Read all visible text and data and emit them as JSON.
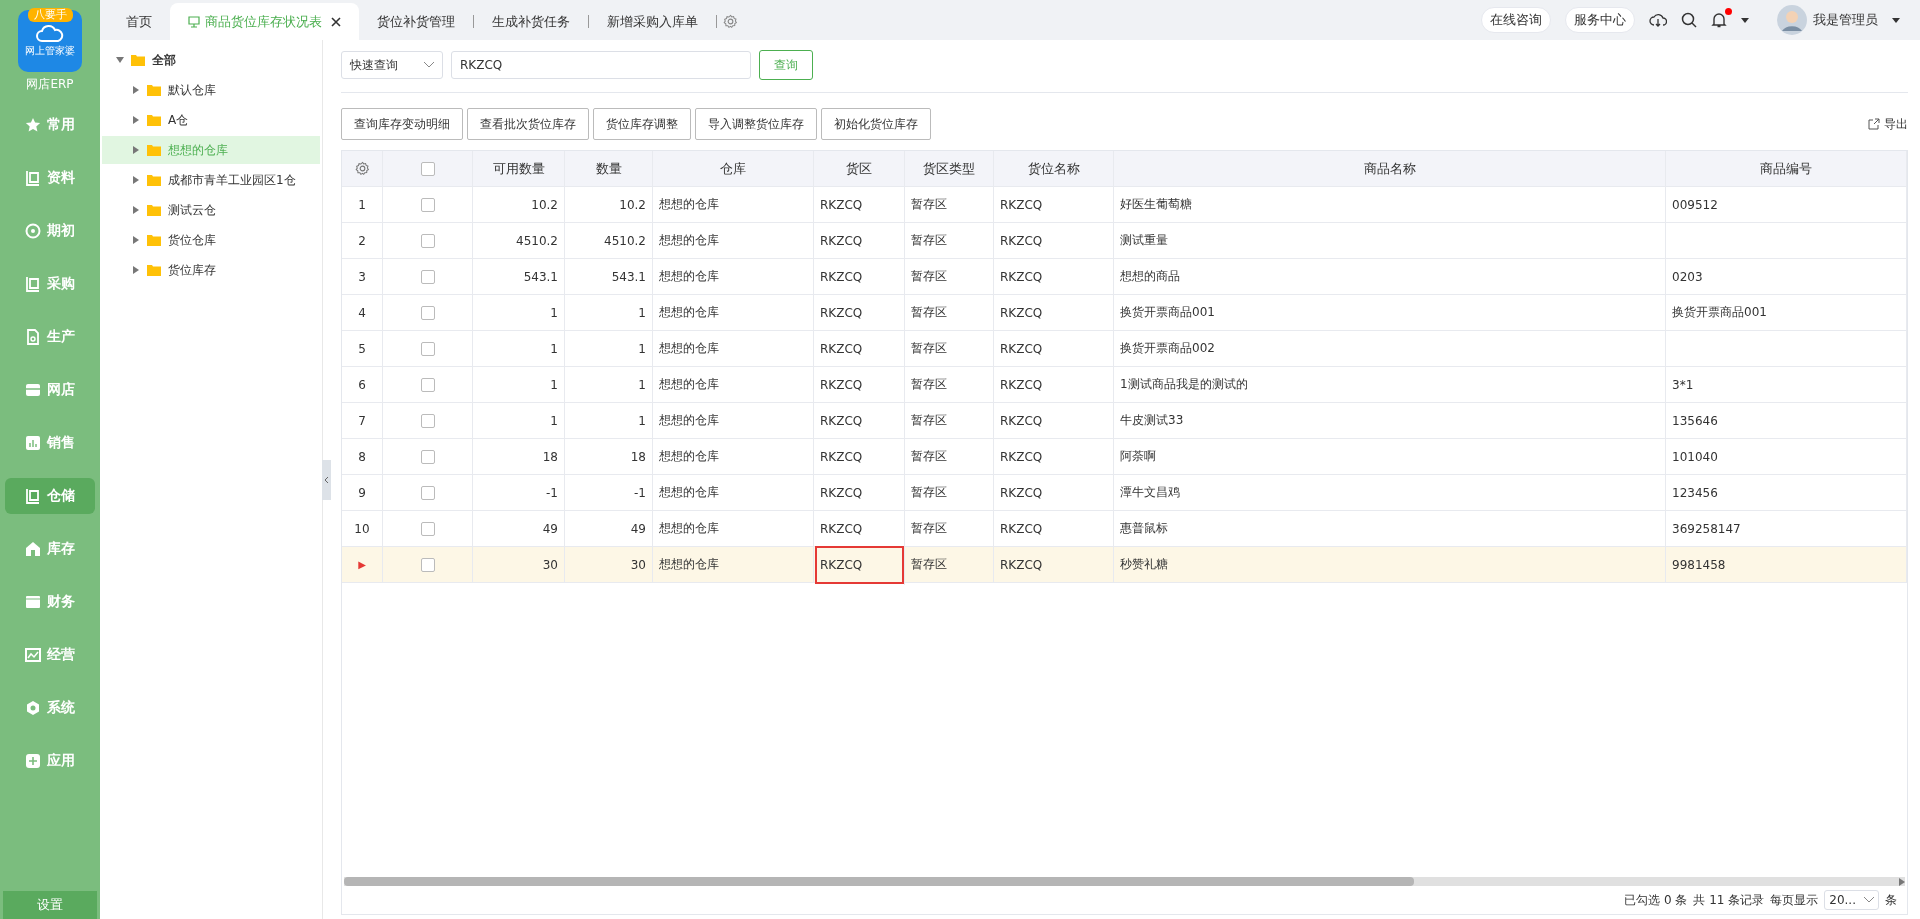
{
  "app": {
    "logo_badge": "八要手",
    "logo_caption": "网上管家婆",
    "name": "网店ERP"
  },
  "nav": [
    {
      "label": "常用",
      "selected": false
    },
    {
      "label": "资料",
      "selected": false
    },
    {
      "label": "期初",
      "selected": false
    },
    {
      "label": "采购",
      "selected": false
    },
    {
      "label": "生产",
      "selected": false
    },
    {
      "label": "网店",
      "selected": false
    },
    {
      "label": "销售",
      "selected": false
    },
    {
      "label": "仓储",
      "selected": true
    },
    {
      "label": "库存",
      "selected": false
    },
    {
      "label": "财务",
      "selected": false
    },
    {
      "label": "经营",
      "selected": false
    },
    {
      "label": "系统",
      "selected": false
    },
    {
      "label": "应用",
      "selected": false
    }
  ],
  "settings_label": "设置",
  "tabs": [
    {
      "label": "首页",
      "selected": false,
      "closable": false
    },
    {
      "label": "商品货位库存状况表",
      "selected": true,
      "closable": true
    },
    {
      "label": "货位补货管理",
      "selected": false,
      "closable": false
    },
    {
      "label": "生成补货任务",
      "selected": false,
      "closable": false
    },
    {
      "label": "新增采购入库单",
      "selected": false,
      "closable": false
    }
  ],
  "header_links": [
    "在线咨询",
    "服务中心"
  ],
  "notifications_unread": true,
  "user_name": "我是管理员",
  "tree": {
    "label": "全部",
    "expanded": true,
    "children": [
      {
        "label": "默认仓库",
        "selected": false
      },
      {
        "label": "A仓",
        "selected": false
      },
      {
        "label": "想想的仓库",
        "selected": true
      },
      {
        "label": "成都市青羊工业园区1仓",
        "selected": false
      },
      {
        "label": "测试云仓",
        "selected": false
      },
      {
        "label": "货位仓库",
        "selected": false
      },
      {
        "label": "货位库存",
        "selected": false
      }
    ]
  },
  "query": {
    "mode": "快速查询",
    "value": "RKZCQ",
    "button": "查询"
  },
  "actions": [
    "查询库存变动明细",
    "查看批次货位库存",
    "货位库存调整",
    "导入调整货位库存",
    "初始化货位库存"
  ],
  "export_label": "导出",
  "table": {
    "all_checked": false,
    "columns": [
      "可用数量",
      "数量",
      "仓库",
      "货区",
      "货区类型",
      "货位名称",
      "商品名称",
      "商品编号"
    ],
    "rows": [
      {
        "no": "1",
        "checked": false,
        "current": false,
        "zone_focused": false,
        "cells": [
          "10.2",
          "10.2",
          "想想的仓库",
          "RKZCQ",
          "暂存区",
          "RKZCQ",
          "好医生葡萄糖",
          "009512"
        ]
      },
      {
        "no": "2",
        "checked": false,
        "current": false,
        "zone_focused": false,
        "cells": [
          "4510.2",
          "4510.2",
          "想想的仓库",
          "RKZCQ",
          "暂存区",
          "RKZCQ",
          "测试重量",
          ""
        ]
      },
      {
        "no": "3",
        "checked": false,
        "current": false,
        "zone_focused": false,
        "cells": [
          "543.1",
          "543.1",
          "想想的仓库",
          "RKZCQ",
          "暂存区",
          "RKZCQ",
          "想想的商品",
          "0203"
        ]
      },
      {
        "no": "4",
        "checked": false,
        "current": false,
        "zone_focused": false,
        "cells": [
          "1",
          "1",
          "想想的仓库",
          "RKZCQ",
          "暂存区",
          "RKZCQ",
          "换货开票商品001",
          "换货开票商品001"
        ]
      },
      {
        "no": "5",
        "checked": false,
        "current": false,
        "zone_focused": false,
        "cells": [
          "1",
          "1",
          "想想的仓库",
          "RKZCQ",
          "暂存区",
          "RKZCQ",
          "换货开票商品002",
          ""
        ]
      },
      {
        "no": "6",
        "checked": false,
        "current": false,
        "zone_focused": false,
        "cells": [
          "1",
          "1",
          "想想的仓库",
          "RKZCQ",
          "暂存区",
          "RKZCQ",
          "1测试商品我是的测试的",
          "3*1"
        ]
      },
      {
        "no": "7",
        "checked": false,
        "current": false,
        "zone_focused": false,
        "cells": [
          "1",
          "1",
          "想想的仓库",
          "RKZCQ",
          "暂存区",
          "RKZCQ",
          "牛皮测试33",
          "135646"
        ]
      },
      {
        "no": "8",
        "checked": false,
        "current": false,
        "zone_focused": false,
        "cells": [
          "18",
          "18",
          "想想的仓库",
          "RKZCQ",
          "暂存区",
          "RKZCQ",
          "阿荼啊",
          "101040"
        ]
      },
      {
        "no": "9",
        "checked": false,
        "current": false,
        "zone_focused": false,
        "cells": [
          "-1",
          "-1",
          "想想的仓库",
          "RKZCQ",
          "暂存区",
          "RKZCQ",
          "潭牛文昌鸡",
          "123456"
        ]
      },
      {
        "no": "10",
        "checked": false,
        "current": false,
        "zone_focused": false,
        "cells": [
          "49",
          "49",
          "想想的仓库",
          "RKZCQ",
          "暂存区",
          "RKZCQ",
          "惠普鼠标",
          "369258147"
        ]
      },
      {
        "no": "▶",
        "checked": false,
        "current": true,
        "zone_focused": true,
        "cells": [
          "30",
          "30",
          "想想的仓库",
          "RKZCQ",
          "暂存区",
          "RKZCQ",
          "秒赞礼糖",
          "9981458"
        ]
      }
    ]
  },
  "footer": {
    "selected_text": "已勾选 0 条",
    "total_text": "共 11 条记录",
    "per_page_label": "每页显示",
    "per_page": "20...",
    "unit": "条"
  }
}
